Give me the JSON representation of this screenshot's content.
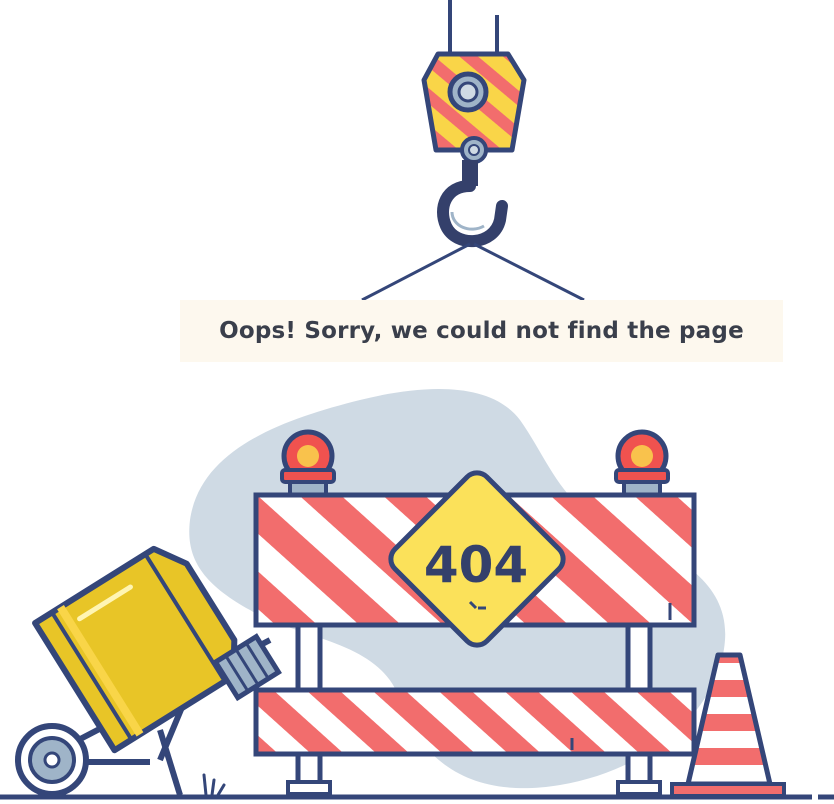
{
  "error": {
    "code": "404",
    "message": "Oops! Sorry, we could not find the page"
  },
  "colors": {
    "outline": "#344679",
    "stripe_red": "#f26d6d",
    "stripe_white": "#ffffff",
    "hook_yellow": "#f9d548",
    "sign_yellow": "#fbe15a",
    "blob": "#cfdae4",
    "message_bg": "#fdf8ee",
    "message_text": "#3a3f4b",
    "lamp_red": "#f0524f",
    "lamp_glow": "#f9c24c",
    "mixer_yellow": "#e8c527"
  },
  "illustration": {
    "icons": [
      "crane-hook-icon",
      "road-barrier-icon",
      "warning-lamp-icon",
      "cement-mixer-icon",
      "traffic-cone-icon"
    ]
  }
}
